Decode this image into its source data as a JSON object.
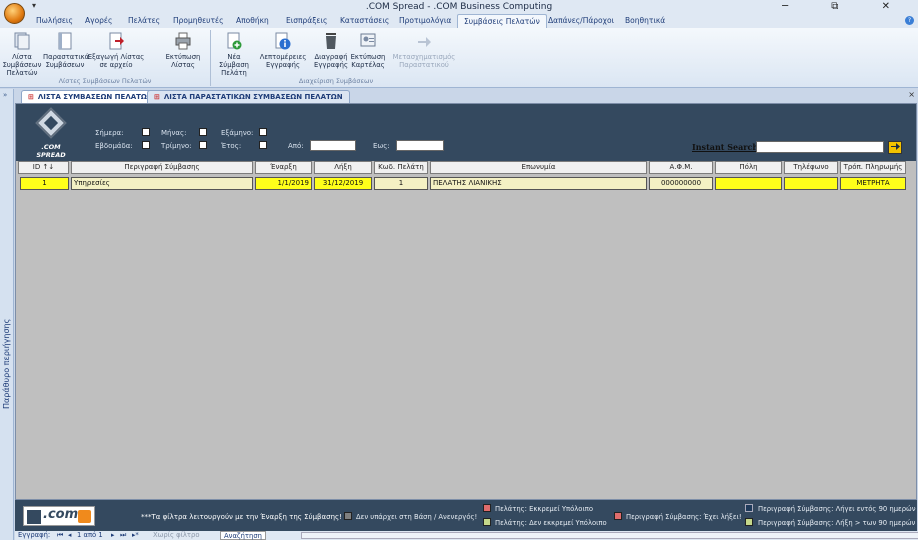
{
  "window": {
    "title": ".COM Spread - .COM Business Computing",
    "controls": "─ ⧉ ✕"
  },
  "quick_access": "▾",
  "menu_tabs": [
    "Πωλήσεις",
    "Αγορές",
    "Πελάτες",
    "Προμηθευτές",
    "Αποθήκη",
    "Εισπράξεις",
    "Καταστάσεις",
    "Προτιμολόγια",
    "Συμβάσεις Πελατών",
    "Δαπάνες/Πάροχοι",
    "Βοηθητικά"
  ],
  "active_menu_tab": "Συμβάσεις Πελατών",
  "ribbon": {
    "groups": [
      {
        "name": "Λίστες Συμβάσεων Πελατών",
        "buttons": [
          "Λίστα Συμβάσεων Πελατών",
          "Παραστατικά Συμβάσεων",
          "Εξαγωγή Λίστας σε αρχείο",
          "Εκτύπωση Λίστας"
        ]
      },
      {
        "name": "Διαχείριση Συμβάσεων",
        "buttons": [
          "Νέα Σύμβαση Πελάτη",
          "Λεπτομέρειες Εγγραφής",
          "Διαγραφή Εγγραφής",
          "Εκτύπωση Καρτέλας",
          "Μετασχηματισμός Παραστατικού"
        ]
      }
    ]
  },
  "navigation_pane": {
    "label": "Παράθυρο περιήγησης",
    "collapse": "»"
  },
  "doc_tabs": [
    "ΛΙΣΤΑ ΣΥΜΒΑΣΕΩΝ ΠΕΛΑΤΩΝ",
    "ΛΙΣΤΑ ΠΑΡΑΣΤΑΤΙΚΩΝ ΣΥΜΒΑΣΕΩΝ ΠΕΛΑΤΩΝ"
  ],
  "doc_close": "×",
  "filters": {
    "logo_text": ".COM SPREAD",
    "today": "Σήμερα:",
    "week": "Εβδομάδα:",
    "month": "Μήνας:",
    "quarter": "Τρίμηνο:",
    "semester": "Εξάμηνο:",
    "year": "Έτος:",
    "from": "Από:",
    "to": "Εως:",
    "from_value": "",
    "to_value": "",
    "instant_search": "Instant Search:",
    "search_value": "",
    "search_button_icon": "arrow-right-icon"
  },
  "table": {
    "columns": [
      "ID ↑↓",
      "Περιγραφή Σύμβασης",
      "Έναρξη",
      "Λήξη",
      "Κωδ. Πελάτη",
      "Επωνυμία",
      "Α.Φ.Μ.",
      "Πόλη",
      "Τηλέφωνο",
      "Τρόπ. Πληρωμής"
    ],
    "rows": [
      {
        "id": "1",
        "description": "Υπηρεσίες",
        "start": "1/1/2019",
        "end": "31/12/2019",
        "customer_code": "1",
        "name": "ΠΕΛΑΤΗΣ ΛΙΑΝΙΚΗΣ",
        "afm": "000000000",
        "city": "",
        "phone": "",
        "payment": "ΜΕΤΡΗΤΑ"
      }
    ]
  },
  "footer": {
    "logo_text": ".com",
    "note": "***Τα φίλτρα λειτουργούν με την Έναρξη της Σύμβασης!",
    "legend": [
      {
        "label": "Δεν υπάρχει στη Βάση / Ανενεργός!",
        "color": "#7f7f7f"
      },
      {
        "label": "Πελάτης: Εκκρεμεί Υπόλοιπο",
        "color": "#e06c6c"
      },
      {
        "label": "Πελάτης: Δεν εκκρεμεί Υπόλοιπο",
        "color": "#c5d88a"
      },
      {
        "label": "Περιγραφή Σύμβασης: Έχει λήξει!",
        "color": "#e06c6c"
      },
      {
        "label": "Περιγραφή Σύμβασης: Λήγει εντός 90 ημερών",
        "color": "#1f3a5a"
      },
      {
        "label": "Περιγραφή Σύμβασης: Λήξη > των 90 ημερών",
        "color": "#c5d88a"
      }
    ]
  },
  "status": {
    "record": "Εγγραφή:",
    "position": "1 από 1",
    "filter": "Χωρίς φίλτρο",
    "search": "Αναζήτηση",
    "nav_first": "⏮",
    "nav_prev": "◂",
    "nav_next": "▸",
    "nav_last": "⏭",
    "nav_new": "▸*"
  }
}
